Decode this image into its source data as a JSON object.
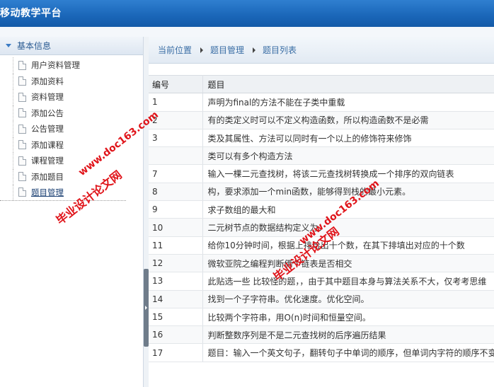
{
  "app": {
    "title": "移动教学平台"
  },
  "sidebar": {
    "header": "基本信息",
    "items": [
      {
        "label": "用户资料管理"
      },
      {
        "label": "添加资料"
      },
      {
        "label": "资料管理"
      },
      {
        "label": "添加公告"
      },
      {
        "label": "公告管理"
      },
      {
        "label": "添加课程"
      },
      {
        "label": "课程管理"
      },
      {
        "label": "添加题目"
      },
      {
        "label": "题目管理",
        "active": true
      }
    ]
  },
  "breadcrumb": {
    "items": [
      "当前位置",
      "题目管理",
      "题目列表"
    ]
  },
  "table": {
    "headers": [
      "编号",
      "题目"
    ],
    "rows": [
      [
        "1",
        "声明为final的方法不能在子类中重载"
      ],
      [
        "2",
        "有的类定义时可以不定义构造函数，所以构造函数不是必需"
      ],
      [
        "3",
        "类及其属性、方法可以同时有一个以上的修饰符来修饰"
      ],
      [
        "",
        "类可以有多个构造方法"
      ],
      [
        "7",
        "输入一棵二元查找树，将该二元查找树转换成一个排序的双向链表"
      ],
      [
        "8",
        "构，要求添加一个min函数，能够得到栈的最小元素。"
      ],
      [
        "9",
        "求子数组的最大和"
      ],
      [
        "10",
        "二元树节点的数据结构定义为："
      ],
      [
        "11",
        "给你10分钟时间，根据上排给出十个数，在其下排填出对应的十个数"
      ],
      [
        "12",
        "微软亚院之编程判断俩个链表是否相交"
      ],
      [
        "13",
        "此贴选一些 比较怪的题，，由于其中题目本身与算法关系不大，仅考考思维"
      ],
      [
        "14",
        "找到一个子字符串。优化速度。优化空间。"
      ],
      [
        "15",
        "比较两个字符串，用O(n)时间和恒量空间。"
      ],
      [
        "16",
        "判断整数序列是不是二元查找树的后序遍历结果"
      ],
      [
        "17",
        "题目：输入一个英文句子，翻转句子中单词的顺序，但单词内字符的顺序不变"
      ]
    ]
  },
  "watermarks": [
    {
      "text": "www.doc163.com"
    },
    {
      "text": "毕业设计论文网"
    },
    {
      "text": "毕业设计论文网"
    },
    {
      "text": "www.doc163.com"
    }
  ],
  "colors": {
    "topbar": "#1a66b8",
    "watermark": "#e0141a",
    "breadcrumb_text": "#3a6ea5"
  }
}
